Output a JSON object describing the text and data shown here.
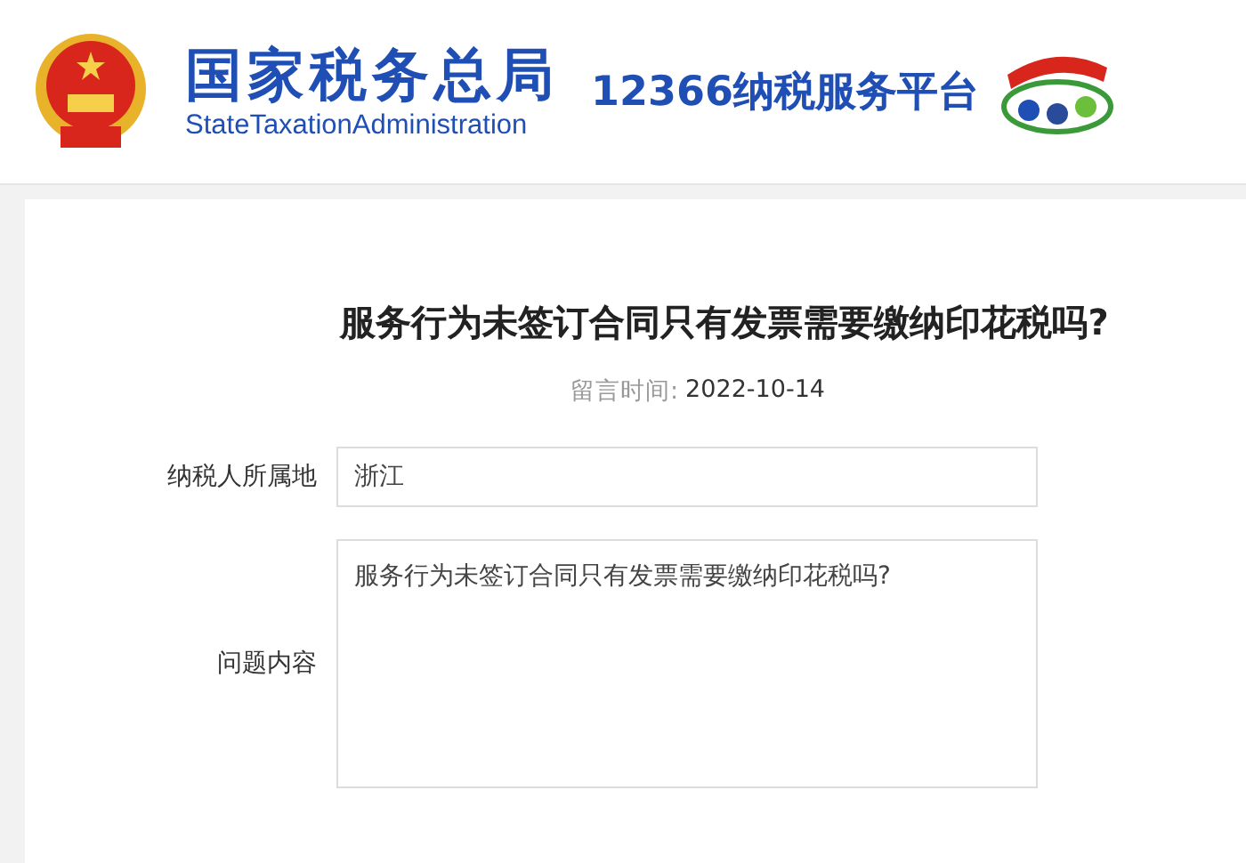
{
  "header": {
    "agency_name": "国家税务总局",
    "agency_name_en": "StateTaxationAdministration",
    "platform_name": "12366纳税服务平台"
  },
  "question": {
    "title": "服务行为未签订合同只有发票需要缴纳印花税吗?",
    "time_label": "留言时间:",
    "time_value": "2022-10-14",
    "fields": [
      {
        "kind": "input",
        "label": "纳税人所属地",
        "value": "浙江"
      },
      {
        "kind": "textarea",
        "label": "问题内容",
        "value": "服务行为未签订合同只有发票需要缴纳印花税吗?"
      }
    ]
  }
}
